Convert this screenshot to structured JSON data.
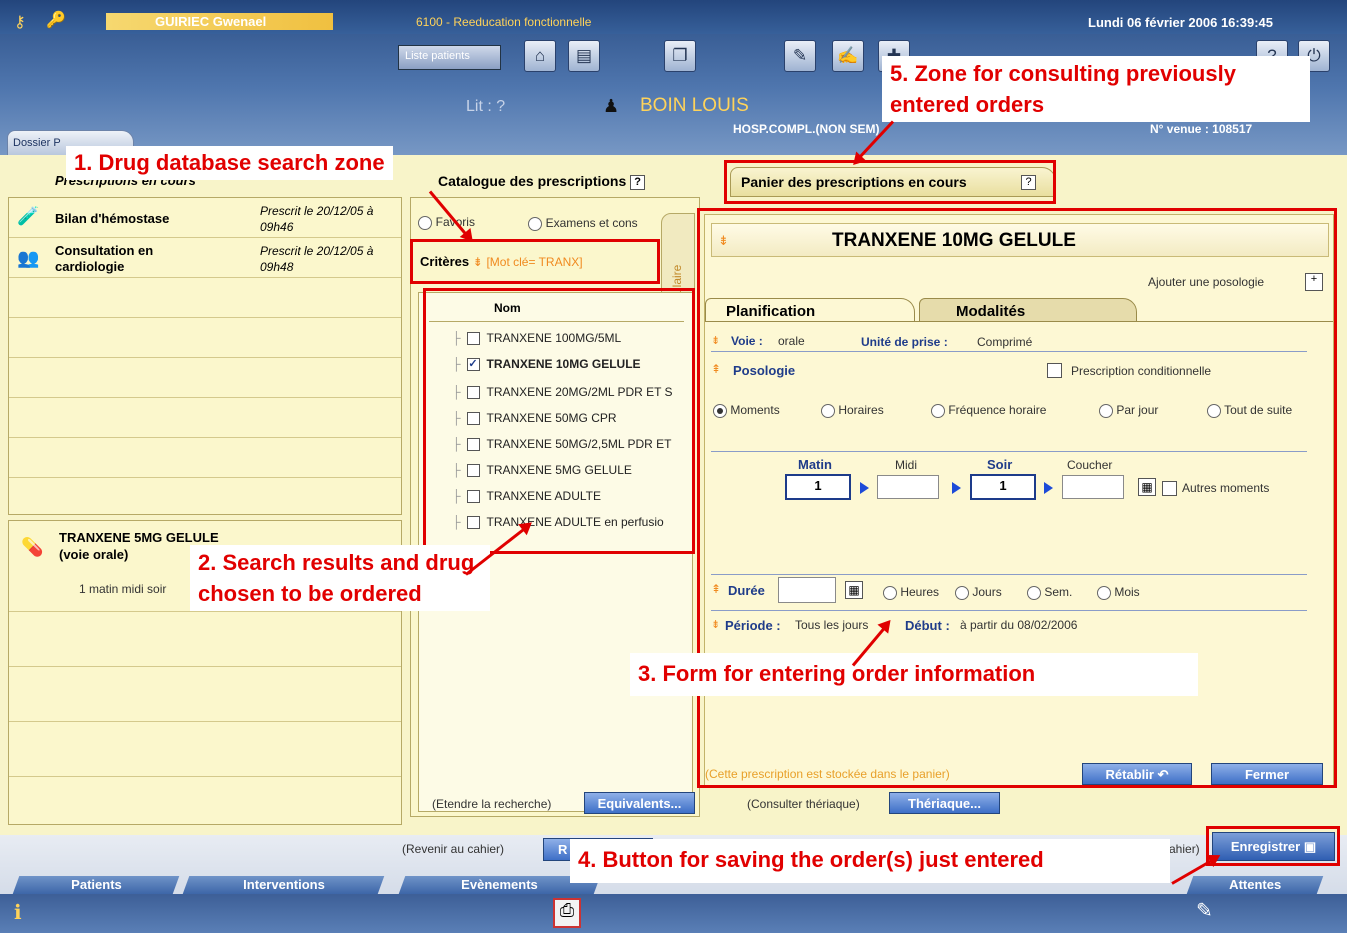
{
  "header": {
    "user": "GUIRIEC Gwenael",
    "unit": "6100 - Reeducation fonctionnelle",
    "datetime": "Lundi 06 février 2006 16:39:45",
    "patients_list_btn": "Liste patients",
    "bed": "Lit : ?",
    "patient_name": "BOIN LOUIS",
    "stay_type": "HOSP.COMPL.(NON SEM)",
    "venue": "N° venue : 108517",
    "dossier_tab": "Dossier P"
  },
  "left": {
    "title": "Prescriptions en cours",
    "items": [
      {
        "name": "Bilan d'hémostase",
        "date": "Prescrit le 20/12/05 à",
        "time": "09h46"
      },
      {
        "name": "Consultation en",
        "name2": "cardiologie",
        "date": "Prescrit le 20/12/05 à",
        "time": "09h48"
      }
    ],
    "selected": {
      "name": "TRANXENE 5MG GELULE",
      "route": "(voie orale)",
      "detail": "1 matin midi soir"
    }
  },
  "catalog": {
    "tab_catalog": "Catalogue des prescriptions",
    "tab_basket": "Panier des prescriptions en cours",
    "help": "?",
    "radio_favoris": "Favoris",
    "radio_examens": "Examens et cons",
    "criteria_label": "Critères",
    "criteria_value": "[Mot clé= TRANX]",
    "side_tab": "Formulaire",
    "col_name": "Nom",
    "drugs": [
      {
        "label": "TRANXENE 100MG/5ML",
        "checked": false
      },
      {
        "label": "TRANXENE 10MG GELULE",
        "checked": true
      },
      {
        "label": "TRANXENE 20MG/2ML PDR ET S",
        "checked": false
      },
      {
        "label": "TRANXENE 50MG CPR",
        "checked": false
      },
      {
        "label": "TRANXENE 50MG/2,5ML PDR ET",
        "checked": false
      },
      {
        "label": "TRANXENE 5MG GELULE",
        "checked": false
      },
      {
        "label": "TRANXENE ADULTE",
        "checked": false
      },
      {
        "label": "TRANXENE ADULTE en perfusio",
        "checked": false
      }
    ],
    "extend_label": "(Etendre la recherche)",
    "equiv_btn": "Equivalents...",
    "theriaque_label": "(Consulter thériaque)",
    "theriaque_btn": "Thériaque..."
  },
  "form": {
    "drug_title": "TRANXENE 10MG GELULE",
    "add_posology": "Ajouter une posologie",
    "tab_planif": "Planification",
    "tab_modal": "Modalités",
    "voie_label": "Voie :",
    "voie_value": "orale",
    "unite_label": "Unité de prise :",
    "unite_value": "Comprimé",
    "posologie": "Posologie",
    "conditional": "Prescription conditionnelle",
    "freq_options": [
      "Moments",
      "Horaires",
      "Fréquence horaire",
      "Par jour",
      "Tout de suite"
    ],
    "moments": {
      "matin": "Matin",
      "midi": "Midi",
      "soir": "Soir",
      "coucher": "Coucher",
      "matin_val": "1",
      "soir_val": "1"
    },
    "autres": "Autres moments",
    "duree": "Durée",
    "duree_units": [
      "Heures",
      "Jours",
      "Sem.",
      "Mois"
    ],
    "periode_label": "Période :",
    "periode_value": "Tous les jours",
    "debut_label": "Début :",
    "debut_value": "à partir du 08/02/2006",
    "stored_note": "(Cette prescription est stockée dans le panier)",
    "retablir": "Rétablir",
    "fermer": "Fermer"
  },
  "bottom": {
    "back_label": "(Revenir au cahier)",
    "back_btn": "R",
    "cahier_label": "cahier)",
    "save_btn": "Enregistrer",
    "tabs": [
      "Patients",
      "Interventions",
      "Evènements",
      "Attentes"
    ]
  },
  "annotations": {
    "a1": "1. Drug database search zone",
    "a2": "2. Search results and drug chosen to be ordered",
    "a3": "3. Form for entering order information",
    "a4": "4. Button for saving the order(s) just entered",
    "a5": "5. Zone for consulting previously entered orders"
  }
}
